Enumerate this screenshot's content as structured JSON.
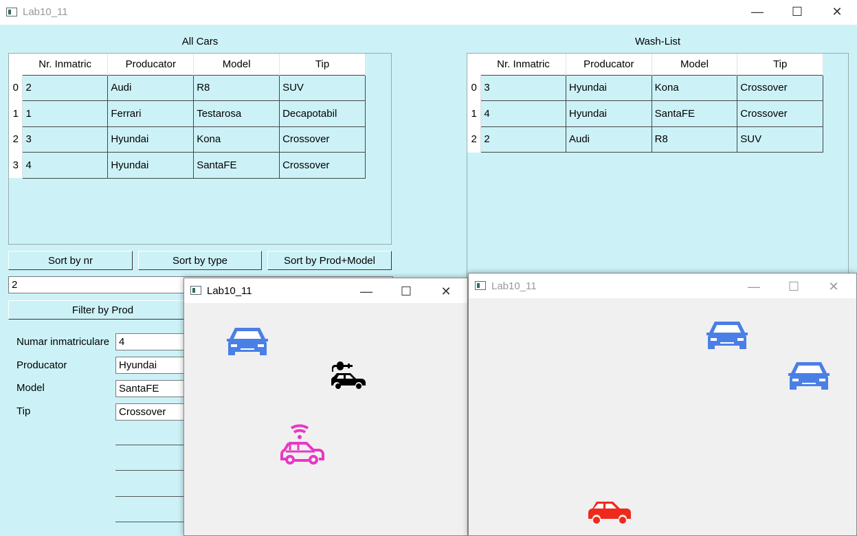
{
  "main_window": {
    "title": "Lab10_11",
    "controls": {
      "minimize": "—",
      "maximize": "☐",
      "close": "✕"
    }
  },
  "all_cars": {
    "title": "All Cars",
    "headers": [
      "Nr. Inmatric",
      "Producator",
      "Model",
      "Tip"
    ],
    "rows": [
      {
        "idx": "0",
        "nr": "2",
        "prod": "Audi",
        "model": "R8",
        "tip": "SUV"
      },
      {
        "idx": "1",
        "nr": "1",
        "prod": "Ferrari",
        "model": "Testarosa",
        "tip": "Decapotabil"
      },
      {
        "idx": "2",
        "nr": "3",
        "prod": "Hyundai",
        "model": "Kona",
        "tip": "Crossover"
      },
      {
        "idx": "3",
        "nr": "4",
        "prod": "Hyundai",
        "model": "SantaFE",
        "tip": "Crossover"
      }
    ]
  },
  "wash_list": {
    "title": "Wash-List",
    "headers": [
      "Nr. Inmatric",
      "Producator",
      "Model",
      "Tip"
    ],
    "rows": [
      {
        "idx": "0",
        "nr": "3",
        "prod": "Hyundai",
        "model": "Kona",
        "tip": "Crossover"
      },
      {
        "idx": "1",
        "nr": "4",
        "prod": "Hyundai",
        "model": "SantaFE",
        "tip": "Crossover"
      },
      {
        "idx": "2",
        "nr": "2",
        "prod": "Audi",
        "model": "R8",
        "tip": "SUV"
      }
    ]
  },
  "sort_buttons": {
    "by_nr": "Sort by nr",
    "by_type": "Sort by type",
    "by_prod_model": "Sort by Prod+Model"
  },
  "filter": {
    "value": "2",
    "button": "Filter by Prod"
  },
  "form": {
    "nr_label": "Numar inmatriculare",
    "nr_value": "4",
    "prod_label": "Producator",
    "prod_value": "Hyundai",
    "model_label": "Model",
    "model_value": "SantaFE",
    "tip_label": "Tip",
    "tip_value": "Crossover"
  },
  "popup_left": {
    "title": "Lab10_11",
    "controls": {
      "minimize": "—",
      "maximize": "☐",
      "close": "✕"
    }
  },
  "popup_right": {
    "title": "Lab10_11",
    "controls": {
      "minimize": "—",
      "maximize": "☐",
      "close": "✕"
    }
  },
  "colors": {
    "client_bg": "#ccf2f7",
    "car_blue": "#4a7fe6",
    "car_black": "#000000",
    "car_pink": "#e838c4",
    "car_red": "#ee2a1c"
  },
  "icons": [
    "car-icon",
    "electric-car-icon",
    "connected-car-icon"
  ]
}
